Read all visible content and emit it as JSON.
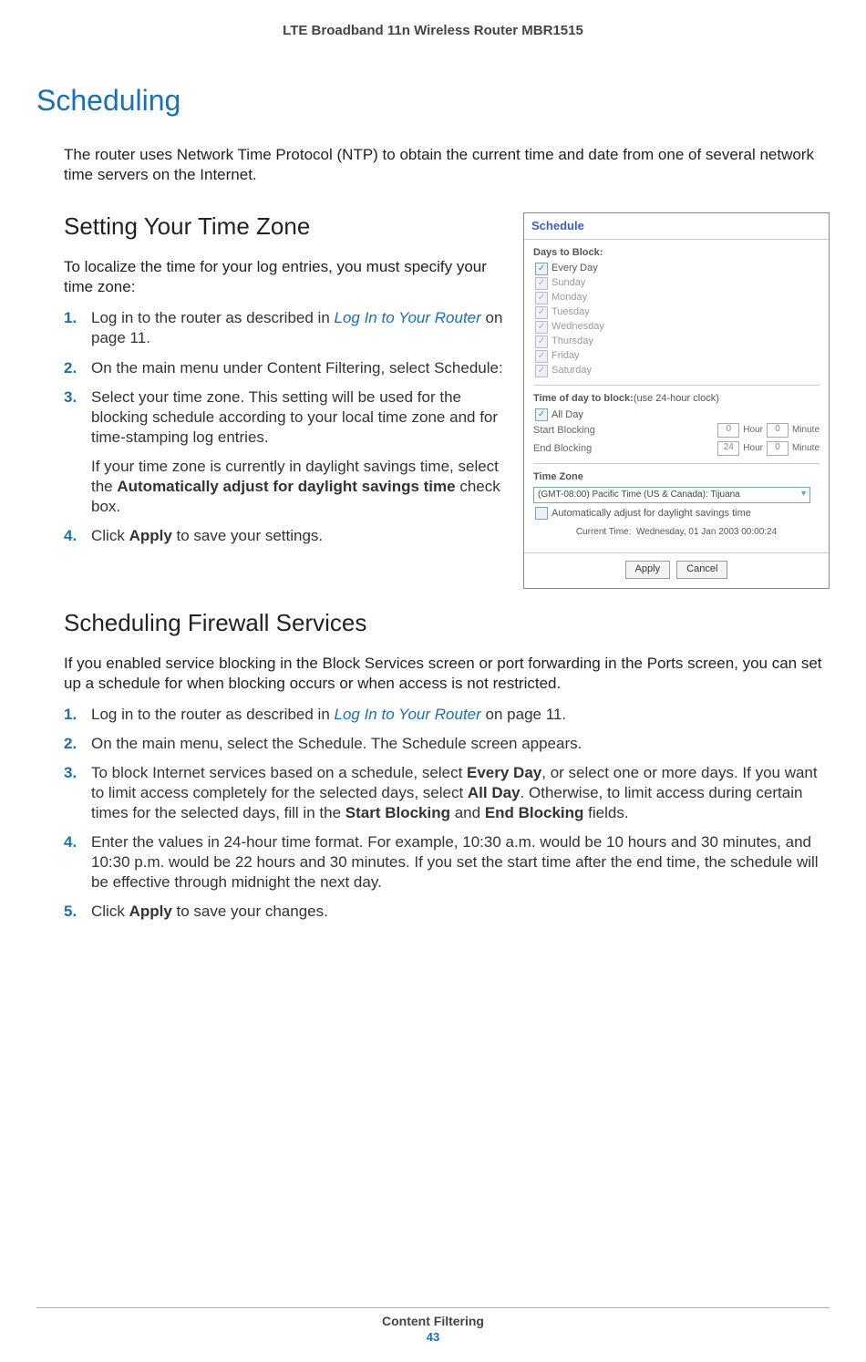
{
  "header": {
    "title": "LTE Broadband 11n Wireless Router MBR1515"
  },
  "h1": "Scheduling",
  "intro": "The router uses Network Time Protocol (NTP) to obtain the current time and date from one of several network time servers on the Internet.",
  "section1": {
    "heading": "Setting Your Time Zone",
    "para": "To localize the time for your log entries, you must specify your time zone:",
    "steps": {
      "s1": {
        "num": "1.",
        "pre": "Log in to the router as described in ",
        "link": "Log In to Your Router",
        "post": " on page 11."
      },
      "s2": {
        "num": "2.",
        "text": "On the main menu under Content Filtering, select Schedule:"
      },
      "s3": {
        "num": "3.",
        "p1": "Select your time zone. This setting will be used for the blocking schedule according to your local time zone and for time-stamping log entries.",
        "p2a": "If your time zone is currently in daylight savings time, select the ",
        "p2b": "Automatically adjust for daylight savings time",
        "p2c": " check box."
      },
      "s4": {
        "num": "4.",
        "pre": "Click ",
        "bold": "Apply",
        "post": " to save your settings."
      }
    }
  },
  "screenshot": {
    "title": "Schedule",
    "days_label": "Days to Block:",
    "days": {
      "every": "Every Day",
      "sun": "Sunday",
      "mon": "Monday",
      "tue": "Tuesday",
      "wed": "Wednesday",
      "thu": "Thursday",
      "fri": "Friday",
      "sat": "Saturday"
    },
    "tod_label": "Time of day to block:",
    "tod_hint": "(use 24-hour clock)",
    "all_day": "All Day",
    "start": "Start Blocking",
    "end": "End Blocking",
    "start_h": "0",
    "start_m": "0",
    "end_h": "24",
    "end_m": "0",
    "hour": "Hour",
    "minute": "Minute",
    "tz_label": "Time Zone",
    "tz_value": "(GMT-08:00) Pacific Time (US & Canada): Tijuana",
    "auto_dst": "Automatically adjust for daylight savings time",
    "current_time_label": "Current Time:",
    "current_time_value": "Wednesday, 01 Jan 2003 00:00:24",
    "apply": "Apply",
    "cancel": "Cancel"
  },
  "section2": {
    "heading": "Scheduling Firewall Services",
    "para": "If you enabled service blocking in the Block Services screen or port forwarding in the Ports screen, you can set up a schedule for when blocking occurs or when access is not restricted.",
    "steps": {
      "s1": {
        "num": "1.",
        "pre": "Log in to the router as described in ",
        "link": "Log In to Your Router",
        "post": " on page 11."
      },
      "s2": {
        "num": "2.",
        "text": "On the main menu, select the Schedule. The Schedule screen appears."
      },
      "s3": {
        "num": "3.",
        "a": "To block Internet services based on a schedule, select ",
        "b": "Every Day",
        "c": ", or select one or more days. If you want to limit access completely for the selected days, select ",
        "d": "All Day",
        "e": ". Otherwise, to limit access during certain times for the selected days, fill in the ",
        "f": "Start Blocking",
        "g": " and ",
        "h": "End Blocking",
        "i": " fields."
      },
      "s4": {
        "num": "4.",
        "text": "Enter the values in 24-hour time format. For example, 10:30 a.m. would be 10 hours and 30 minutes, and 10:30 p.m. would be 22 hours and 30 minutes. If you set the start time after the end time, the schedule will be effective through midnight the next day."
      },
      "s5": {
        "num": "5.",
        "pre": "Click ",
        "bold": "Apply",
        "post": " to save your changes."
      }
    }
  },
  "footer": {
    "title": "Content Filtering",
    "page": "43"
  }
}
